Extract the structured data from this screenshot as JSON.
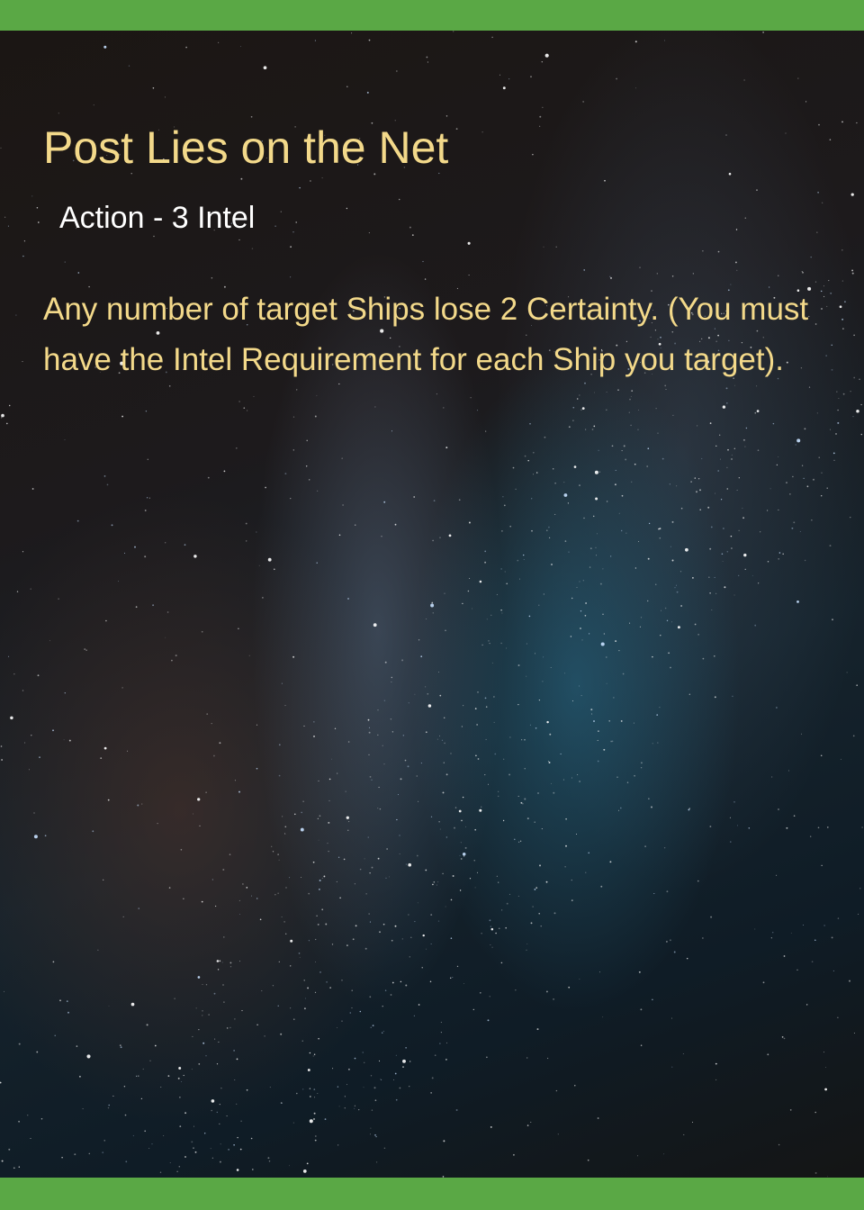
{
  "card": {
    "title": "Post Lies on the Net",
    "type_line": "Action - 3 Intel",
    "rules_text": "Any number of target Ships lose 2 Certainty. (You must have the Intel Requirement for each Ship you target)."
  },
  "colors": {
    "border_green": "#5aa845",
    "title_gold": "#f3d98a",
    "type_white": "#ffffff",
    "space_dark": "#1c1410"
  },
  "background": {
    "image": "starfield-milky-way"
  }
}
